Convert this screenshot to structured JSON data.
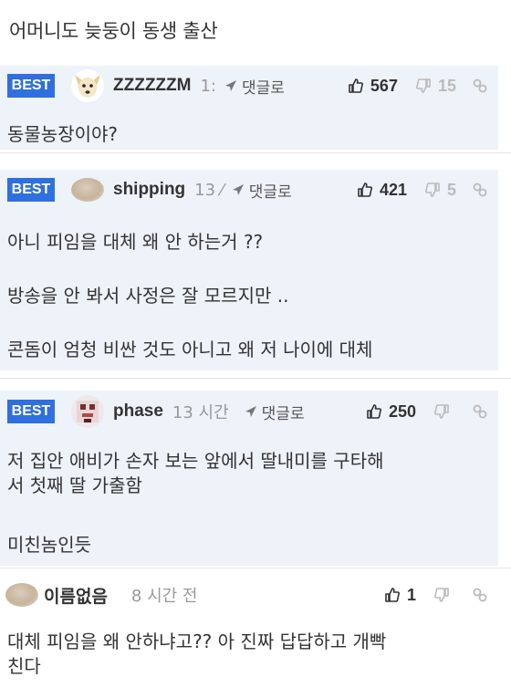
{
  "post": {
    "title": "어머니도 늦둥이 동생 출산"
  },
  "labels": {
    "best": "BEST",
    "reply": "댓글로"
  },
  "colors": {
    "best_badge": "#2f6fe0",
    "best_background": "#eef2f9"
  },
  "comments": [
    {
      "best": true,
      "avatar": "dog-avatar-icon",
      "username": "ZZZZZZM",
      "time": "1:",
      "likes": "567",
      "dislikes": "15",
      "lines": [
        "동물농장이야?"
      ]
    },
    {
      "best": true,
      "avatar": "blurred-avatar",
      "username": "shipping",
      "time": "13 ⁄",
      "likes": "421",
      "dislikes": "5",
      "lines": [
        "아니 피임을 대체 왜 안 하는거 ??",
        "방송을 안 봐서 사정은 잘 모르지만 ..",
        "콘돔이 엄청 비싼 것도 아니고 왜 저 나이에 대체"
      ]
    },
    {
      "best": true,
      "avatar": "pixel-avatar",
      "username": "phase",
      "time": "13 시간",
      "likes": "250",
      "dislikes": "",
      "lines": [
        "저 집안 애비가 손자 보는 앞에서 딸내미를 구타해",
        "서 첫째 딸 가출함",
        "미친놈인듯"
      ]
    },
    {
      "best": false,
      "avatar": "blurred-avatar",
      "username": "이름없음",
      "time": "8 시간 전",
      "likes": "1",
      "dislikes": "",
      "lines": [
        "대체 피임을 왜 안하냐고?? 아 진짜 답답하고 개빡",
        "친다"
      ]
    }
  ]
}
